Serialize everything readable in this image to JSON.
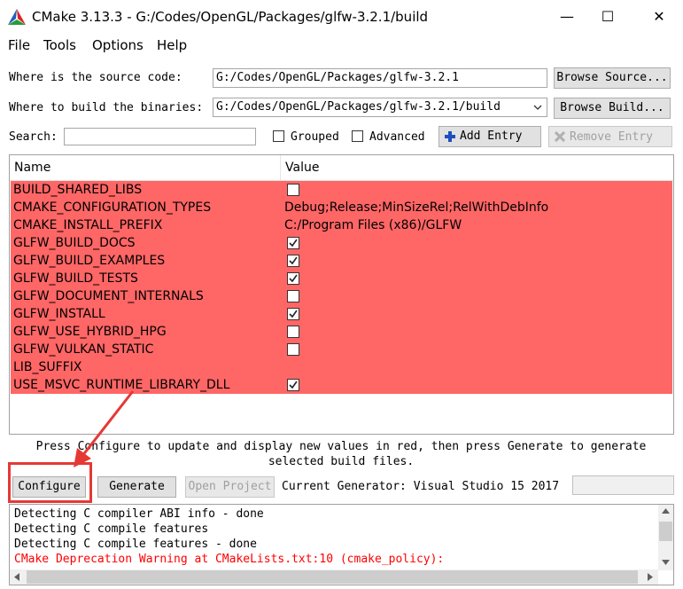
{
  "window": {
    "title": "CMake 3.13.3 - G:/Codes/OpenGL/Packages/glfw-3.2.1/build",
    "minimize": "—",
    "maximize": "☐",
    "close": "✕"
  },
  "menu": [
    "File",
    "Tools",
    "Options",
    "Help"
  ],
  "source": {
    "label": "Where is the source code:",
    "value": "G:/Codes/OpenGL/Packages/glfw-3.2.1",
    "button": "Browse Source..."
  },
  "build": {
    "label": "Where to build the binaries:",
    "value": "G:/Codes/OpenGL/Packages/glfw-3.2.1/build",
    "button": "Browse Build..."
  },
  "search": {
    "label": "Search:",
    "value": "",
    "grouped_label": "Grouped",
    "grouped_checked": false,
    "advanced_label": "Advanced",
    "advanced_checked": false,
    "add_entry": "Add Entry",
    "remove_entry": "Remove Entry"
  },
  "table": {
    "headers": [
      "Name",
      "Value"
    ],
    "highlight_color": "#ff6666",
    "rows": [
      {
        "name": "BUILD_SHARED_LIBS",
        "type": "bool",
        "checked": false
      },
      {
        "name": "CMAKE_CONFIGURATION_TYPES",
        "type": "text",
        "value": "Debug;Release;MinSizeRel;RelWithDebInfo"
      },
      {
        "name": "CMAKE_INSTALL_PREFIX",
        "type": "text",
        "value": "C:/Program Files (x86)/GLFW"
      },
      {
        "name": "GLFW_BUILD_DOCS",
        "type": "bool",
        "checked": true
      },
      {
        "name": "GLFW_BUILD_EXAMPLES",
        "type": "bool",
        "checked": true
      },
      {
        "name": "GLFW_BUILD_TESTS",
        "type": "bool",
        "checked": true
      },
      {
        "name": "GLFW_DOCUMENT_INTERNALS",
        "type": "bool",
        "checked": false
      },
      {
        "name": "GLFW_INSTALL",
        "type": "bool",
        "checked": true
      },
      {
        "name": "GLFW_USE_HYBRID_HPG",
        "type": "bool",
        "checked": false
      },
      {
        "name": "GLFW_VULKAN_STATIC",
        "type": "bool",
        "checked": false
      },
      {
        "name": "LIB_SUFFIX",
        "type": "text",
        "value": ""
      },
      {
        "name": "USE_MSVC_RUNTIME_LIBRARY_DLL",
        "type": "bool",
        "checked": true
      }
    ]
  },
  "hint": "Press Configure to update and display new values in red, then press Generate to generate selected build files.",
  "actions": {
    "configure": "Configure",
    "generate": "Generate",
    "open_project": "Open Project",
    "generator": "Current Generator: Visual Studio 15 2017"
  },
  "output": [
    {
      "text": "Detecting C compiler ABI info - done",
      "color": "#000000"
    },
    {
      "text": "Detecting C compile features",
      "color": "#000000"
    },
    {
      "text": "Detecting C compile features - done",
      "color": "#000000"
    },
    {
      "text": "CMake Deprecation Warning at CMakeLists.txt:10 (cmake_policy):",
      "color": "#ff0000"
    }
  ],
  "annotation_color": "#e53935"
}
